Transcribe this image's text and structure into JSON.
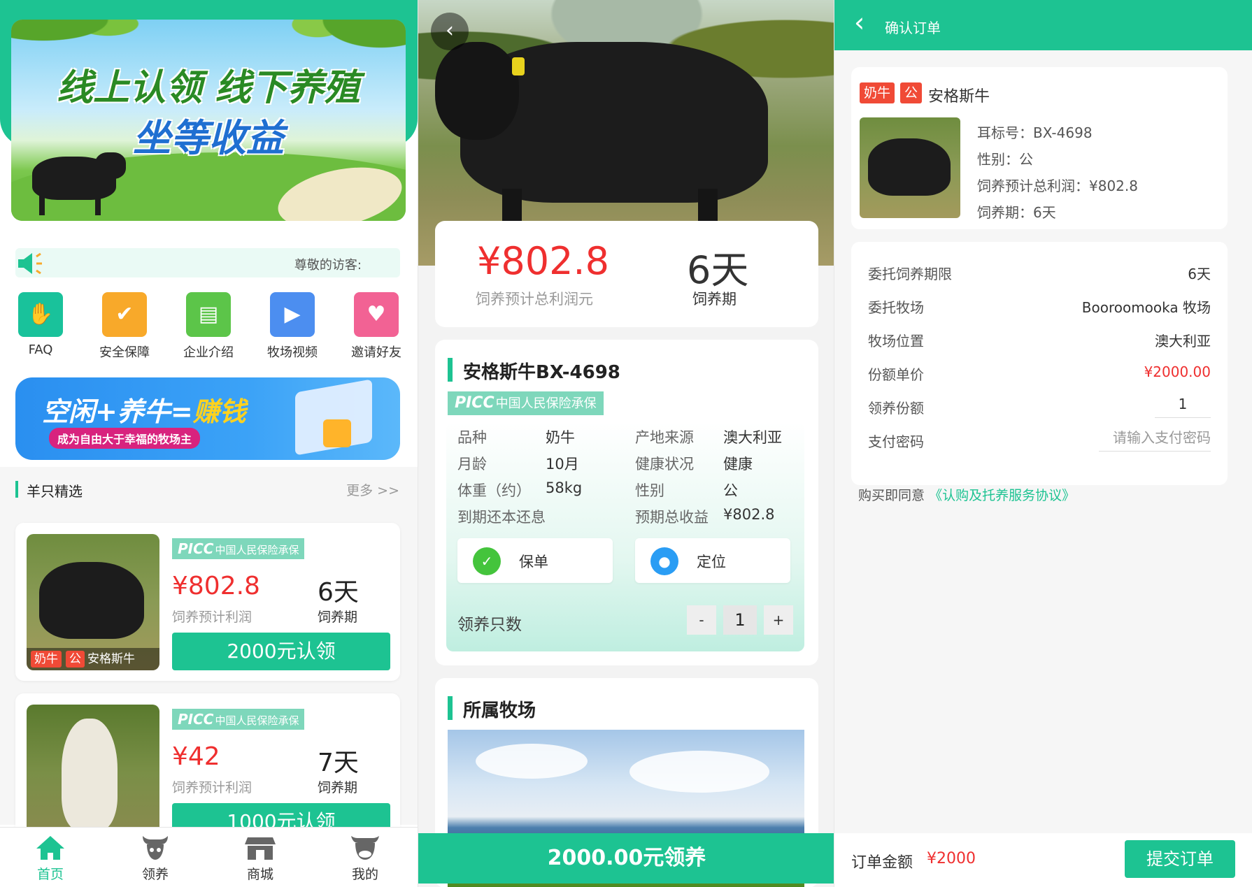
{
  "home": {
    "banner": {
      "line1": "线上认领 线下养殖",
      "line2": "坐等收益"
    },
    "notice": "尊敬的访客:",
    "shortcuts": [
      {
        "label": "FAQ",
        "icon": "handshake-icon",
        "color": "#19c29b"
      },
      {
        "label": "安全保障",
        "icon": "shield-check-icon",
        "color": "#f8a92a"
      },
      {
        "label": "企业介绍",
        "icon": "document-icon",
        "color": "#5cc549"
      },
      {
        "label": "牧场视频",
        "icon": "video-camera-icon",
        "color": "#4c8ef0"
      },
      {
        "label": "邀请好友",
        "icon": "gift-invite-icon",
        "color": "#f26294"
      }
    ],
    "promo": {
      "title_a": "空闲+养牛=",
      "title_b": "赚钱",
      "subtitle": "成为自由大于幸福的牧场主"
    },
    "section": {
      "title": "羊只精选",
      "more": "更多 >>"
    },
    "products": [
      {
        "picc": "中国人民保险承保",
        "picc_logo": "PICC",
        "price": "¥802.8",
        "days": "6天",
        "price_label": "饲养预计利润",
        "days_label": "饲养期",
        "button": "2000元认领",
        "tags": [
          "奶牛",
          "公"
        ],
        "name": "安格斯牛"
      },
      {
        "picc": "中国人民保险承保",
        "picc_logo": "PICC",
        "price": "¥42",
        "days": "7天",
        "price_label": "饲养预计利润",
        "days_label": "饲养期",
        "button": "1000元认领"
      }
    ],
    "tabs": [
      {
        "label": "首页",
        "icon": "home-icon",
        "active": true
      },
      {
        "label": "领养",
        "icon": "bull-head-icon",
        "active": false
      },
      {
        "label": "商城",
        "icon": "store-icon",
        "active": false
      },
      {
        "label": "我的",
        "icon": "bull-face-icon",
        "active": false
      }
    ]
  },
  "detail": {
    "price": "¥802.8",
    "price_label": "饲养预计总利润元",
    "days": "6天",
    "days_label": "饲养期",
    "title": "安格斯牛BX-4698",
    "picc_logo": "PICC",
    "picc": "中国人民保险承保",
    "info": [
      {
        "k1": "品种",
        "v1": "奶牛",
        "k2": "产地来源",
        "v2": "澳大利亚"
      },
      {
        "k1": "月龄",
        "v1": "10月",
        "k2": "健康状况",
        "v2": "健康"
      },
      {
        "k1": "体重（约）",
        "v1": "58kg",
        "k2": "性别",
        "v2": "公"
      },
      {
        "k1": "到期还本还息",
        "v1": "",
        "k2": "预期总收益",
        "v2": "¥802.8"
      }
    ],
    "policy_button": "保单",
    "location_button": "定位",
    "qty_label": "领养只数",
    "qty_minus": "-",
    "qty_value": "1",
    "qty_plus": "+",
    "farm_title": "所属牧场",
    "cta": "2000.00元领养"
  },
  "order": {
    "header": "确认订单",
    "tags": [
      "奶牛",
      "公"
    ],
    "name": "安格斯牛",
    "lines": [
      "耳标号：BX-4698",
      "性别：公",
      "饲养预计总利润：¥802.8",
      "饲养期：6天"
    ],
    "rows": [
      {
        "k": "委托饲养期限",
        "v": "6天"
      },
      {
        "k": "委托牧场",
        "v": "Booroomooka 牧场"
      },
      {
        "k": "牧场位置",
        "v": "澳大利亚"
      },
      {
        "k": "份额单价",
        "v": "¥2000.00"
      },
      {
        "k": "领养份额",
        "v": "1"
      },
      {
        "k": "支付密码",
        "v": "请输入支付密码"
      }
    ],
    "agree_text": "购买即同意",
    "agree_link": "《认购及托养服务协议》",
    "total_label": "订单金额",
    "total": "¥2000",
    "submit": "提交订单"
  }
}
